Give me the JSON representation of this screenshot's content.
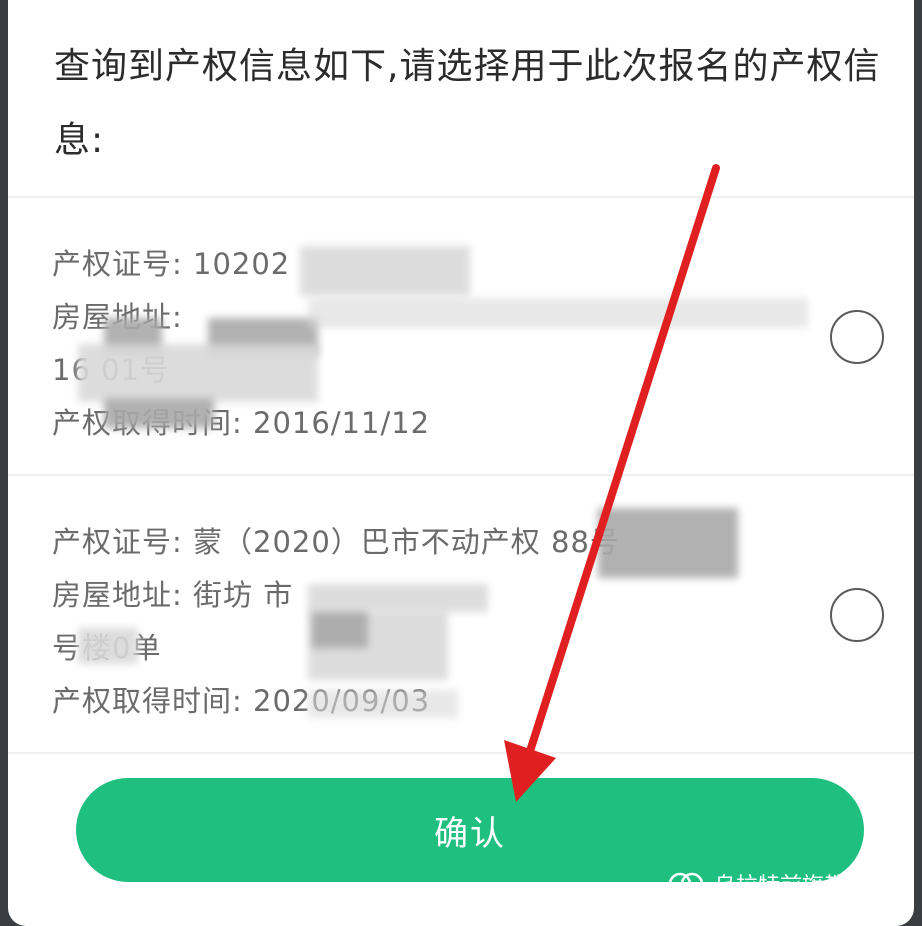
{
  "dialog": {
    "prompt": "查询到产权信息如下,请选择用于此次报名的产权信息:",
    "records": [
      {
        "cert": "产权证号: 10202",
        "address": "房屋地址:",
        "address_cont": "16          01号",
        "date": "产权取得时间: 2016/11/12"
      },
      {
        "cert": "产权证号: 蒙（2020）巴市不动产权         88号",
        "address": "房屋地址:                       街坊                   市",
        "address_cont": "     号楼0单",
        "date": "产权取得时间: 2020/09/03"
      }
    ],
    "confirm_label": "确认"
  },
  "watermark": {
    "text": "乌拉特前旗教育局"
  },
  "colors": {
    "accent": "#1fbf80",
    "arrow": "#e02020"
  }
}
